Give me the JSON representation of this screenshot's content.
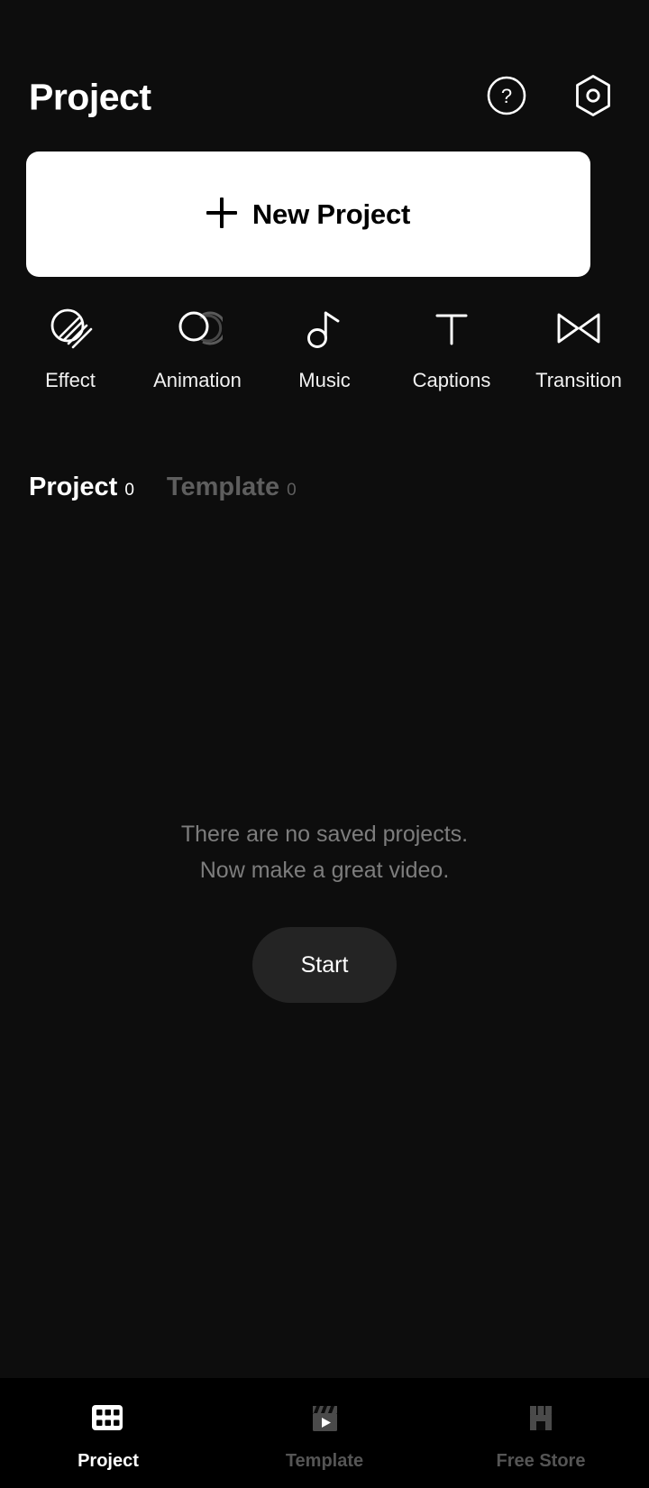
{
  "header": {
    "title": "Project",
    "help_icon": "help-circle-icon",
    "settings_icon": "hex-settings-icon"
  },
  "new_project": {
    "label": "New Project",
    "plus_icon": "plus-icon",
    "background": "#ffffff",
    "text_color": "#000000"
  },
  "features": [
    {
      "label": "Effect",
      "icon": "effect-hatched-circle-icon"
    },
    {
      "label": "Animation",
      "icon": "animation-motion-trail-icon"
    },
    {
      "label": "Music",
      "icon": "music-note-icon"
    },
    {
      "label": "Captions",
      "icon": "text-t-icon"
    },
    {
      "label": "Transition",
      "icon": "transition-bowtie-icon"
    }
  ],
  "tabs": [
    {
      "label": "Project",
      "count": "0",
      "active": true
    },
    {
      "label": "Template",
      "count": "0",
      "active": false
    }
  ],
  "empty_state": {
    "line1": "There are no saved projects.",
    "line2": "Now make a great video.",
    "button_label": "Start"
  },
  "bottom_nav": [
    {
      "label": "Project",
      "icon": "film-strip-icon",
      "active": true
    },
    {
      "label": "Template",
      "icon": "clapperboard-icon",
      "active": false
    },
    {
      "label": "Free Store",
      "icon": "storefront-icon",
      "active": false
    }
  ],
  "colors": {
    "background": "#0d0d0d",
    "nav_background": "#000000",
    "accent": "#ffffff",
    "muted": "#5e5e5e",
    "start_button": "#242424"
  }
}
